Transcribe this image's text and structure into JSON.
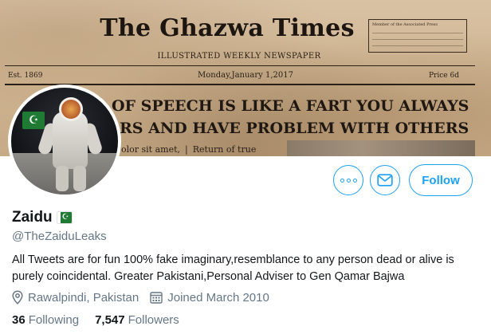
{
  "banner": {
    "newspaper_title": "The Ghazwa Times",
    "subtitle": "ILLUSTRATED WEEKLY NEWSPAPER",
    "est": "Est. 1869",
    "date": "Monday,January 1,2017",
    "price": "Price 6d",
    "box_title": "Member of the Associated Press",
    "headline_line1": "OF SPEECH IS LIKE A FART YOU ALWAYS",
    "headline_line2": "RS AND HAVE PROBLEM WITH OTHERS",
    "body_left": "olor sit amet,",
    "body_right": "Return of true"
  },
  "actions": {
    "more_icon": "more-dots-icon",
    "message_icon": "envelope-icon",
    "follow_label": "Follow"
  },
  "profile": {
    "name": "Zaidu",
    "handle": "@TheZaiduLeaks",
    "bio": "All Tweets are for fun 100% fake imaginary,resemblance to any person dead or alive is purely coincidental. Greater Pakistani,Personal Adviser to Gen Qamar Bajwa",
    "location": "Rawalpindi, Pakistan",
    "joined": "Joined March 2010",
    "following_count": "36",
    "following_label": "Following",
    "followers_count": "7,547",
    "followers_label": "Followers"
  },
  "colors": {
    "accent": "#1da1f2",
    "secondary_text": "#657786",
    "primary_text": "#14171a",
    "flag_green": "#1f7a33"
  }
}
